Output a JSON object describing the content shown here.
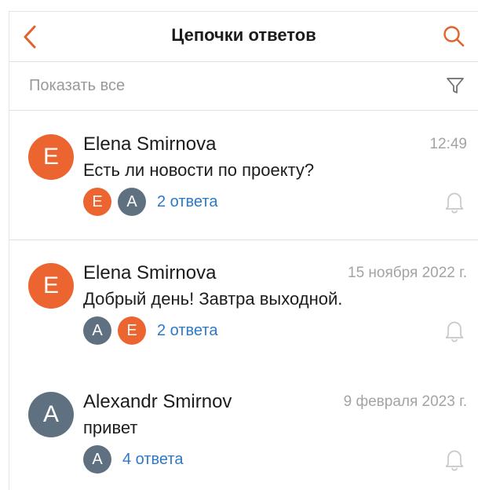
{
  "colors": {
    "accent": "#e2622d",
    "avatar_e": "#ec6430",
    "avatar_a": "#5f7180",
    "link": "#2e78c8",
    "muted": "#a3a3a7"
  },
  "header": {
    "back_icon": "chevron-left-icon",
    "title": "Цепочки ответов",
    "search_icon": "search-icon"
  },
  "filter": {
    "label": "Показать все",
    "icon": "filter-icon"
  },
  "threads": [
    {
      "avatar_letter": "E",
      "avatar_color": "#ec6430",
      "name": "Elena Smirnova",
      "time": "12:49",
      "message": "Есть ли новости по проекту?",
      "participants": [
        {
          "letter": "E",
          "color": "#ec6430"
        },
        {
          "letter": "A",
          "color": "#5f7180"
        }
      ],
      "replies": "2 ответа",
      "bell_icon": "bell-icon"
    },
    {
      "avatar_letter": "E",
      "avatar_color": "#ec6430",
      "name": "Elena Smirnova",
      "time": "15 ноября 2022 г.",
      "message": "Добрый день! Завтра выходной.",
      "participants": [
        {
          "letter": "A",
          "color": "#5f7180"
        },
        {
          "letter": "E",
          "color": "#ec6430"
        }
      ],
      "replies": "2 ответа",
      "bell_icon": "bell-icon"
    },
    {
      "avatar_letter": "A",
      "avatar_color": "#5f7180",
      "name": "Alexandr Smirnov",
      "time": "9 февраля 2023 г.",
      "message": "привет",
      "participants": [
        {
          "letter": "A",
          "color": "#5f7180"
        }
      ],
      "replies": "4 ответа",
      "bell_icon": "bell-icon"
    }
  ]
}
